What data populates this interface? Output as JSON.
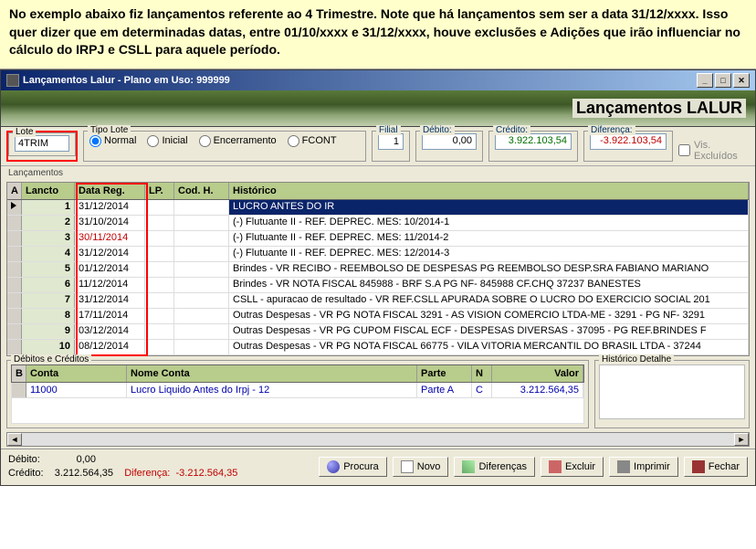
{
  "note": "No exemplo abaixo fiz lançamentos referente ao 4 Trimestre. Note que há lançamentos sem ser a data 31/12/xxxx. Isso quer dizer que em determinadas datas, entre 01/10/xxxx e 31/12/xxxx, houve exclusões e Adições que irão influenciar no cálculo do IRPJ e CSLL para aquele período.",
  "window": {
    "title": "Lançamentos Lalur - Plano em Uso: 999999",
    "header_title": "Lançamentos LALUR"
  },
  "form": {
    "lote_label": "Lote",
    "lote_value": "4TRIM",
    "tipo_lote_label": "Tipo Lote",
    "tipo_normal": "Normal",
    "tipo_inicial": "Inicial",
    "tipo_encerramento": "Encerramento",
    "tipo_fcont": "FCONT",
    "filial_label": "Filial",
    "filial_value": "1",
    "debito_label": "Débito:",
    "debito_value": "0,00",
    "credito_label": "Crédito:",
    "credito_value": "3.922.103,54",
    "diferenca_label": "Diferença:",
    "diferenca_value": "-3.922.103,54",
    "vis_excluidos": "Vis. Excluídos"
  },
  "lancamentos_label": "Lançamentos",
  "grid": {
    "headers": {
      "a": "A",
      "lancto": "Lancto",
      "data_reg": "Data Reg.",
      "lp": "LP.",
      "cod_h": "Cod. H.",
      "historico": "Histórico"
    },
    "rows": [
      {
        "n": "1",
        "data": "31/12/2014",
        "hist": "LUCRO ANTES DO IR",
        "selected": true
      },
      {
        "n": "2",
        "data": "31/10/2014",
        "hist": "(-) Flutuante II - REF. DEPREC. MES: 10/2014-1"
      },
      {
        "n": "3",
        "data": "30/11/2014",
        "red": true,
        "hist": "(-) Flutuante II - REF. DEPREC. MES: 11/2014-2"
      },
      {
        "n": "4",
        "data": "31/12/2014",
        "hist": "(-) Flutuante II - REF. DEPREC. MES: 12/2014-3"
      },
      {
        "n": "5",
        "data": "01/12/2014",
        "hist": "Brindes - VR RECIBO  - REEMBOLSO DE DESPESAS PG REEMBOLSO DESP.SRA FABIANO MARIANO"
      },
      {
        "n": "6",
        "data": "11/12/2014",
        "hist": "Brindes - VR NOTA FISCAL 845988 - BRF S.A PG NF- 845988  CF.CHQ 37237 BANESTES"
      },
      {
        "n": "7",
        "data": "31/12/2014",
        "hist": "CSLL - apuracao de resultado - VR REF.CSLL APURADA SOBRE O LUCRO DO EXERCICIO SOCIAL 201"
      },
      {
        "n": "8",
        "data": "17/11/2014",
        "hist": "Outras Despesas - VR PG NOTA FISCAL 3291 - AS VISION COMERCIO LTDA-ME - 3291 - PG NF- 3291"
      },
      {
        "n": "9",
        "data": "03/12/2014",
        "hist": "Outras Despesas - VR PG CUPOM FISCAL ECF  - DESPESAS DIVERSAS - 37095 - PG REF.BRINDES F"
      },
      {
        "n": "10",
        "data": "08/12/2014",
        "hist": "Outras Despesas - VR PG NOTA FISCAL 66775 - VILA VITORIA MERCANTIL DO BRASIL LTDA - 37244"
      }
    ]
  },
  "dc": {
    "title": "Débitos e Créditos",
    "headers": {
      "b": "B",
      "conta": "Conta",
      "nome": "Nome Conta",
      "parte": "Parte",
      "n": "N",
      "valor": "Valor"
    },
    "row": {
      "conta": "11000",
      "nome": "Lucro Liquido Antes do Irpj - 12",
      "parte": "Parte A",
      "n": "C",
      "valor": "3.212.564,35"
    },
    "hist_det_label": "Histórico Detalhe"
  },
  "footer": {
    "debito_label": "Débito:",
    "debito_value": "0,00",
    "credito_label": "Crédito:",
    "credito_value": "3.212.564,35",
    "diferenca_label": "Diferença:",
    "diferenca_value": "-3.212.564,35",
    "procura": "Procura",
    "novo": "Novo",
    "diferencas": "Diferenças",
    "excluir": "Excluir",
    "imprimir": "Imprimir",
    "fechar": "Fechar"
  }
}
